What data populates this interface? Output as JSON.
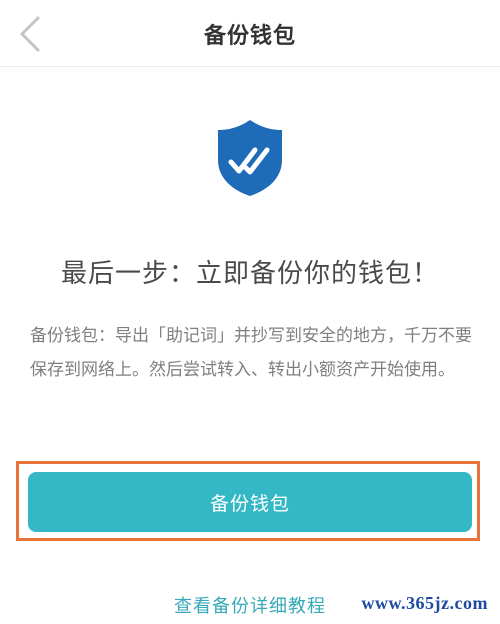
{
  "nav": {
    "title": "备份钱包",
    "back_icon": "chevron-left-icon"
  },
  "hero": {
    "icon": "shield-check-icon",
    "shield_color": "#1e6bb8",
    "headline": "最后一步：立即备份你的钱包！"
  },
  "description": "备份钱包：导出「助记词」并抄写到安全的地方，千万不要保存到网络上。然后尝试转入、转出小额资产开始使用。",
  "primary_button": {
    "label": "备份钱包",
    "color": "#35b8c6",
    "highlight_color": "#e8733a"
  },
  "tutorial_link": "查看备份详细教程",
  "watermark": "www.365jz.com"
}
